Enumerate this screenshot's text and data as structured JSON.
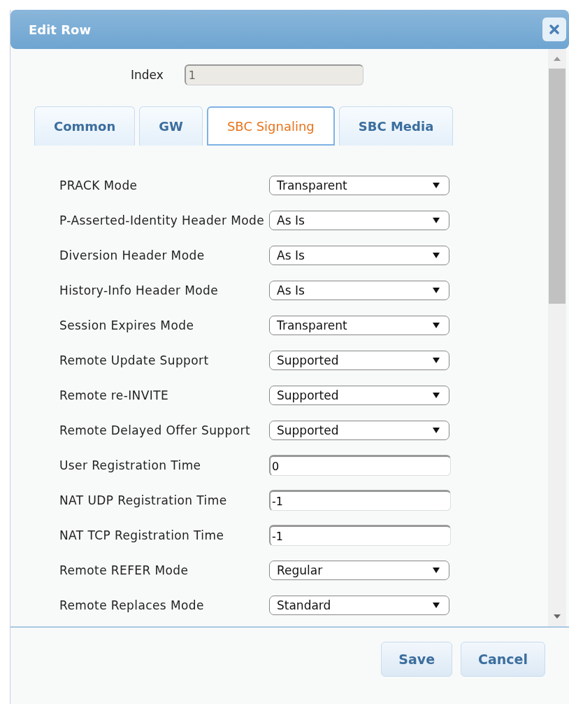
{
  "window": {
    "title": "Edit Row"
  },
  "index": {
    "label": "Index",
    "value": "1",
    "disabled": true
  },
  "tabs": [
    {
      "label": "Common",
      "selected": false
    },
    {
      "label": "GW",
      "selected": false
    },
    {
      "label": "SBC Signaling",
      "selected": true
    },
    {
      "label": "SBC Media",
      "selected": false
    }
  ],
  "fields": [
    {
      "label": "PRACK Mode",
      "kind": "select",
      "value": "Transparent"
    },
    {
      "label": "P-Asserted-Identity Header Mode",
      "kind": "select",
      "value": "As Is"
    },
    {
      "label": "Diversion Header Mode",
      "kind": "select",
      "value": "As Is"
    },
    {
      "label": "History-Info Header Mode",
      "kind": "select",
      "value": "As Is"
    },
    {
      "label": "Session Expires Mode",
      "kind": "select",
      "value": "Transparent"
    },
    {
      "label": "Remote Update Support",
      "kind": "select",
      "value": "Supported"
    },
    {
      "label": "Remote re-INVITE",
      "kind": "select",
      "value": "Supported"
    },
    {
      "label": "Remote Delayed Offer Support",
      "kind": "select",
      "value": "Supported"
    },
    {
      "label": "User Registration Time",
      "kind": "input",
      "value": "0"
    },
    {
      "label": "NAT UDP Registration Time",
      "kind": "input",
      "value": "-1"
    },
    {
      "label": "NAT TCP Registration Time",
      "kind": "input",
      "value": "-1"
    },
    {
      "label": "Remote REFER Mode",
      "kind": "select",
      "value": "Regular"
    },
    {
      "label": "Remote Replaces Mode",
      "kind": "select",
      "value": "Standard"
    }
  ],
  "buttons": [
    "Save",
    "Cancel"
  ]
}
